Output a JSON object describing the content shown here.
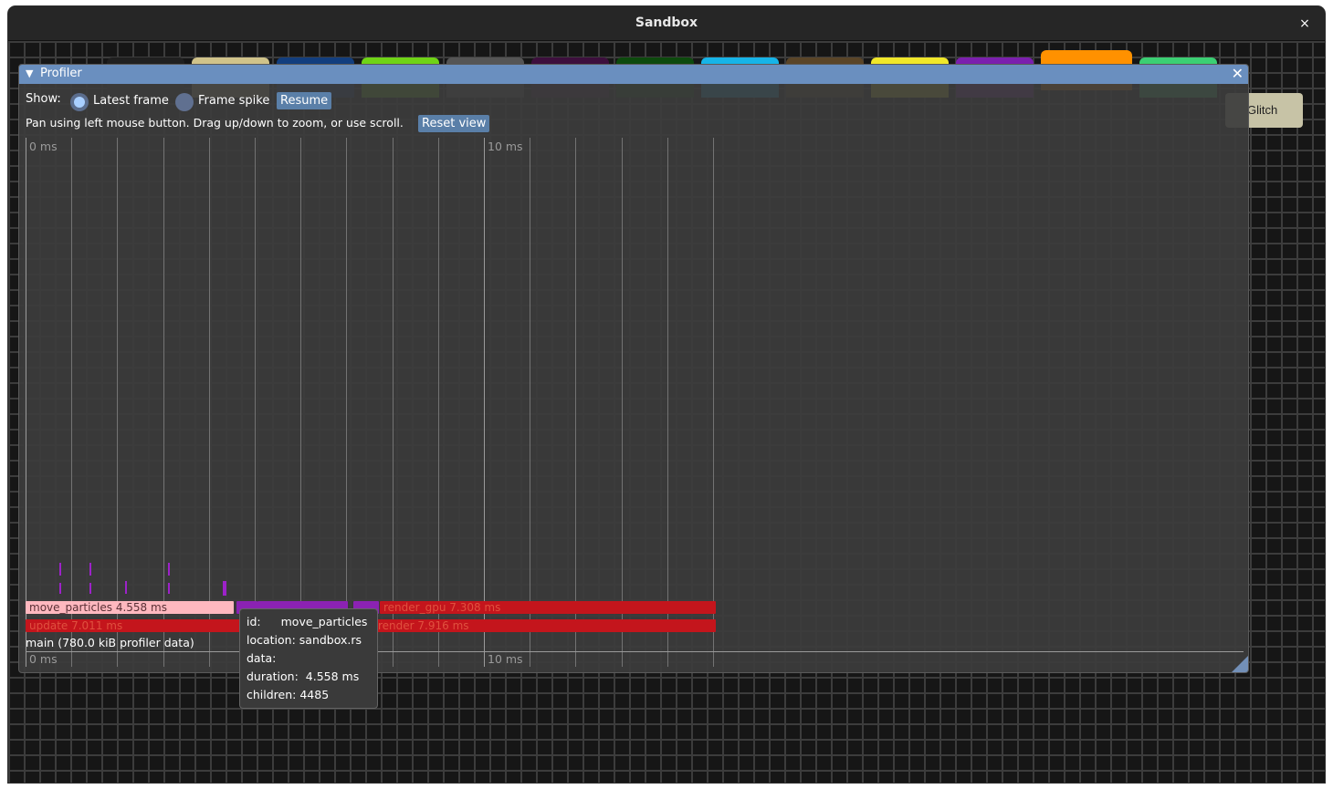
{
  "window": {
    "title": "Sandbox",
    "close_glyph": "×"
  },
  "background_tiles": [
    {
      "color": "#202020"
    },
    {
      "color": "#d0c38a"
    },
    {
      "color": "#123e7e"
    },
    {
      "color": "#6fd316"
    },
    {
      "color": "#555555"
    },
    {
      "color": "#3d0f3d"
    },
    {
      "color": "#0d4a0d"
    },
    {
      "color": "#16b4e8"
    },
    {
      "color": "#5a4528"
    },
    {
      "color": "#f0e72a"
    },
    {
      "color": "#7b1fae"
    },
    {
      "color": "#ff9100"
    },
    {
      "color": "#3bcf73"
    }
  ],
  "glitch_tile": {
    "label": "Glitch"
  },
  "profiler": {
    "title": "Profiler",
    "collapse_glyph": "▼",
    "close_glyph": "✕",
    "show_label": "Show:",
    "options": [
      {
        "label": "Latest frame",
        "selected": true
      },
      {
        "label": "Frame spike",
        "selected": false
      }
    ],
    "resume_label": "Resume",
    "hint": "Pan using left mouse button. Drag up/down to zoom, or use scroll.",
    "reset_view_label": "Reset view",
    "axis_labels_top": [
      "0 ms",
      "10 ms"
    ],
    "axis_labels_bottom": [
      "0 ms",
      "10 ms"
    ],
    "thread_label": "main (780.0 kiB profiler data)",
    "scopes": {
      "move_particles": "move_particles  4.558 ms",
      "render_gpu": "render_gpu  7.308 ms",
      "update": "update  7.011 ms",
      "render": "render  7.916 ms"
    }
  },
  "tooltip": {
    "id_key": "id:",
    "id_value": "move_particles",
    "location": "location: sandbox.rs",
    "data": "data:",
    "duration_key": "duration:",
    "duration_value": "4.558 ms",
    "children": "children: 4485"
  },
  "colors": {
    "header_blue": "#6a8fbf",
    "scope_red": "#c4151c",
    "scope_pink": "#ffb8bf",
    "scope_purple": "#8b22b3"
  }
}
